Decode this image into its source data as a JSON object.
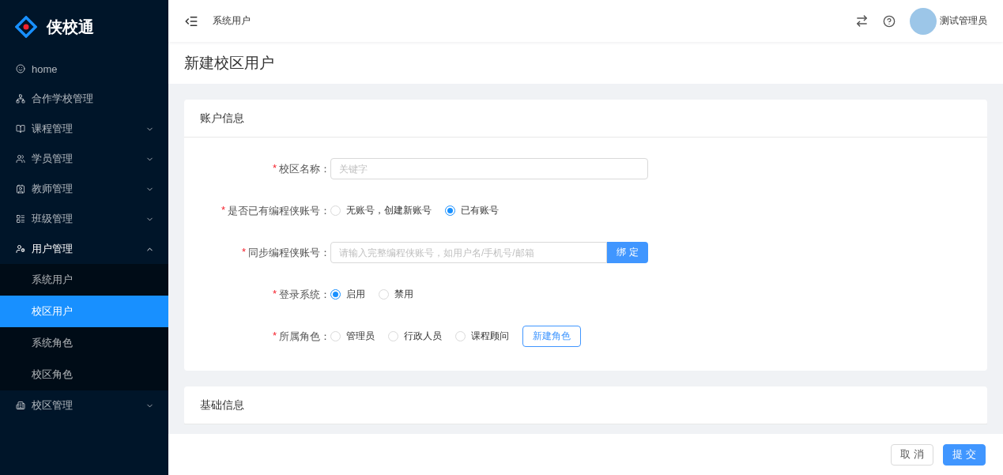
{
  "brand": {
    "name": "侠校通"
  },
  "sidebar": {
    "items": [
      {
        "label": "home"
      },
      {
        "label": "合作学校管理"
      },
      {
        "label": "课程管理",
        "expanded": false
      },
      {
        "label": "学员管理",
        "expanded": false
      },
      {
        "label": "教师管理",
        "expanded": false
      },
      {
        "label": "班级管理",
        "expanded": false
      },
      {
        "label": "用户管理",
        "expanded": true,
        "children": [
          {
            "label": "系统用户",
            "selected": false
          },
          {
            "label": "校区用户",
            "selected": true
          },
          {
            "label": "系统角色",
            "selected": false
          },
          {
            "label": "校区角色",
            "selected": false
          }
        ]
      },
      {
        "label": "校区管理",
        "expanded": false
      }
    ]
  },
  "header": {
    "breadcrumb": "系统用户",
    "user": "测试管理员"
  },
  "page_title": "新建校区用户",
  "cards": [
    {
      "title": "账户信息",
      "fields": [
        {
          "kind": "text",
          "mark": "*",
          "label": "校区名称：",
          "placeholder": "关键字"
        },
        {
          "kind": "radio",
          "mark": "*",
          "label": "是否已有编程侠账号：",
          "options": [
            {
              "label": "无账号，创建新账号",
              "selected": false
            },
            {
              "label": "已有账号",
              "selected": true
            }
          ]
        },
        {
          "kind": "search",
          "mark": "*",
          "label": "同步编程侠账号：",
          "placeholder": "请输入完整编程侠账号，如用户名/手机号/邮箱",
          "button": "绑 定"
        },
        {
          "kind": "radio",
          "mark": "*",
          "label": "登录系统：",
          "options": [
            {
              "label": "启用",
              "selected": true
            },
            {
              "label": "禁用",
              "selected": false
            }
          ]
        },
        {
          "kind": "radio",
          "mark": "*",
          "label": "所属角色：",
          "options": [
            {
              "label": "管理员",
              "selected": false
            },
            {
              "label": "行政人员",
              "selected": false
            },
            {
              "label": "课程顾问",
              "selected": false
            }
          ],
          "button": "新建角色"
        }
      ]
    },
    {
      "title": "基础信息"
    }
  ],
  "footer": {
    "buttons": [
      {
        "label": "取 消",
        "kind": "default"
      },
      {
        "label": "提 交",
        "kind": "primary"
      }
    ]
  }
}
